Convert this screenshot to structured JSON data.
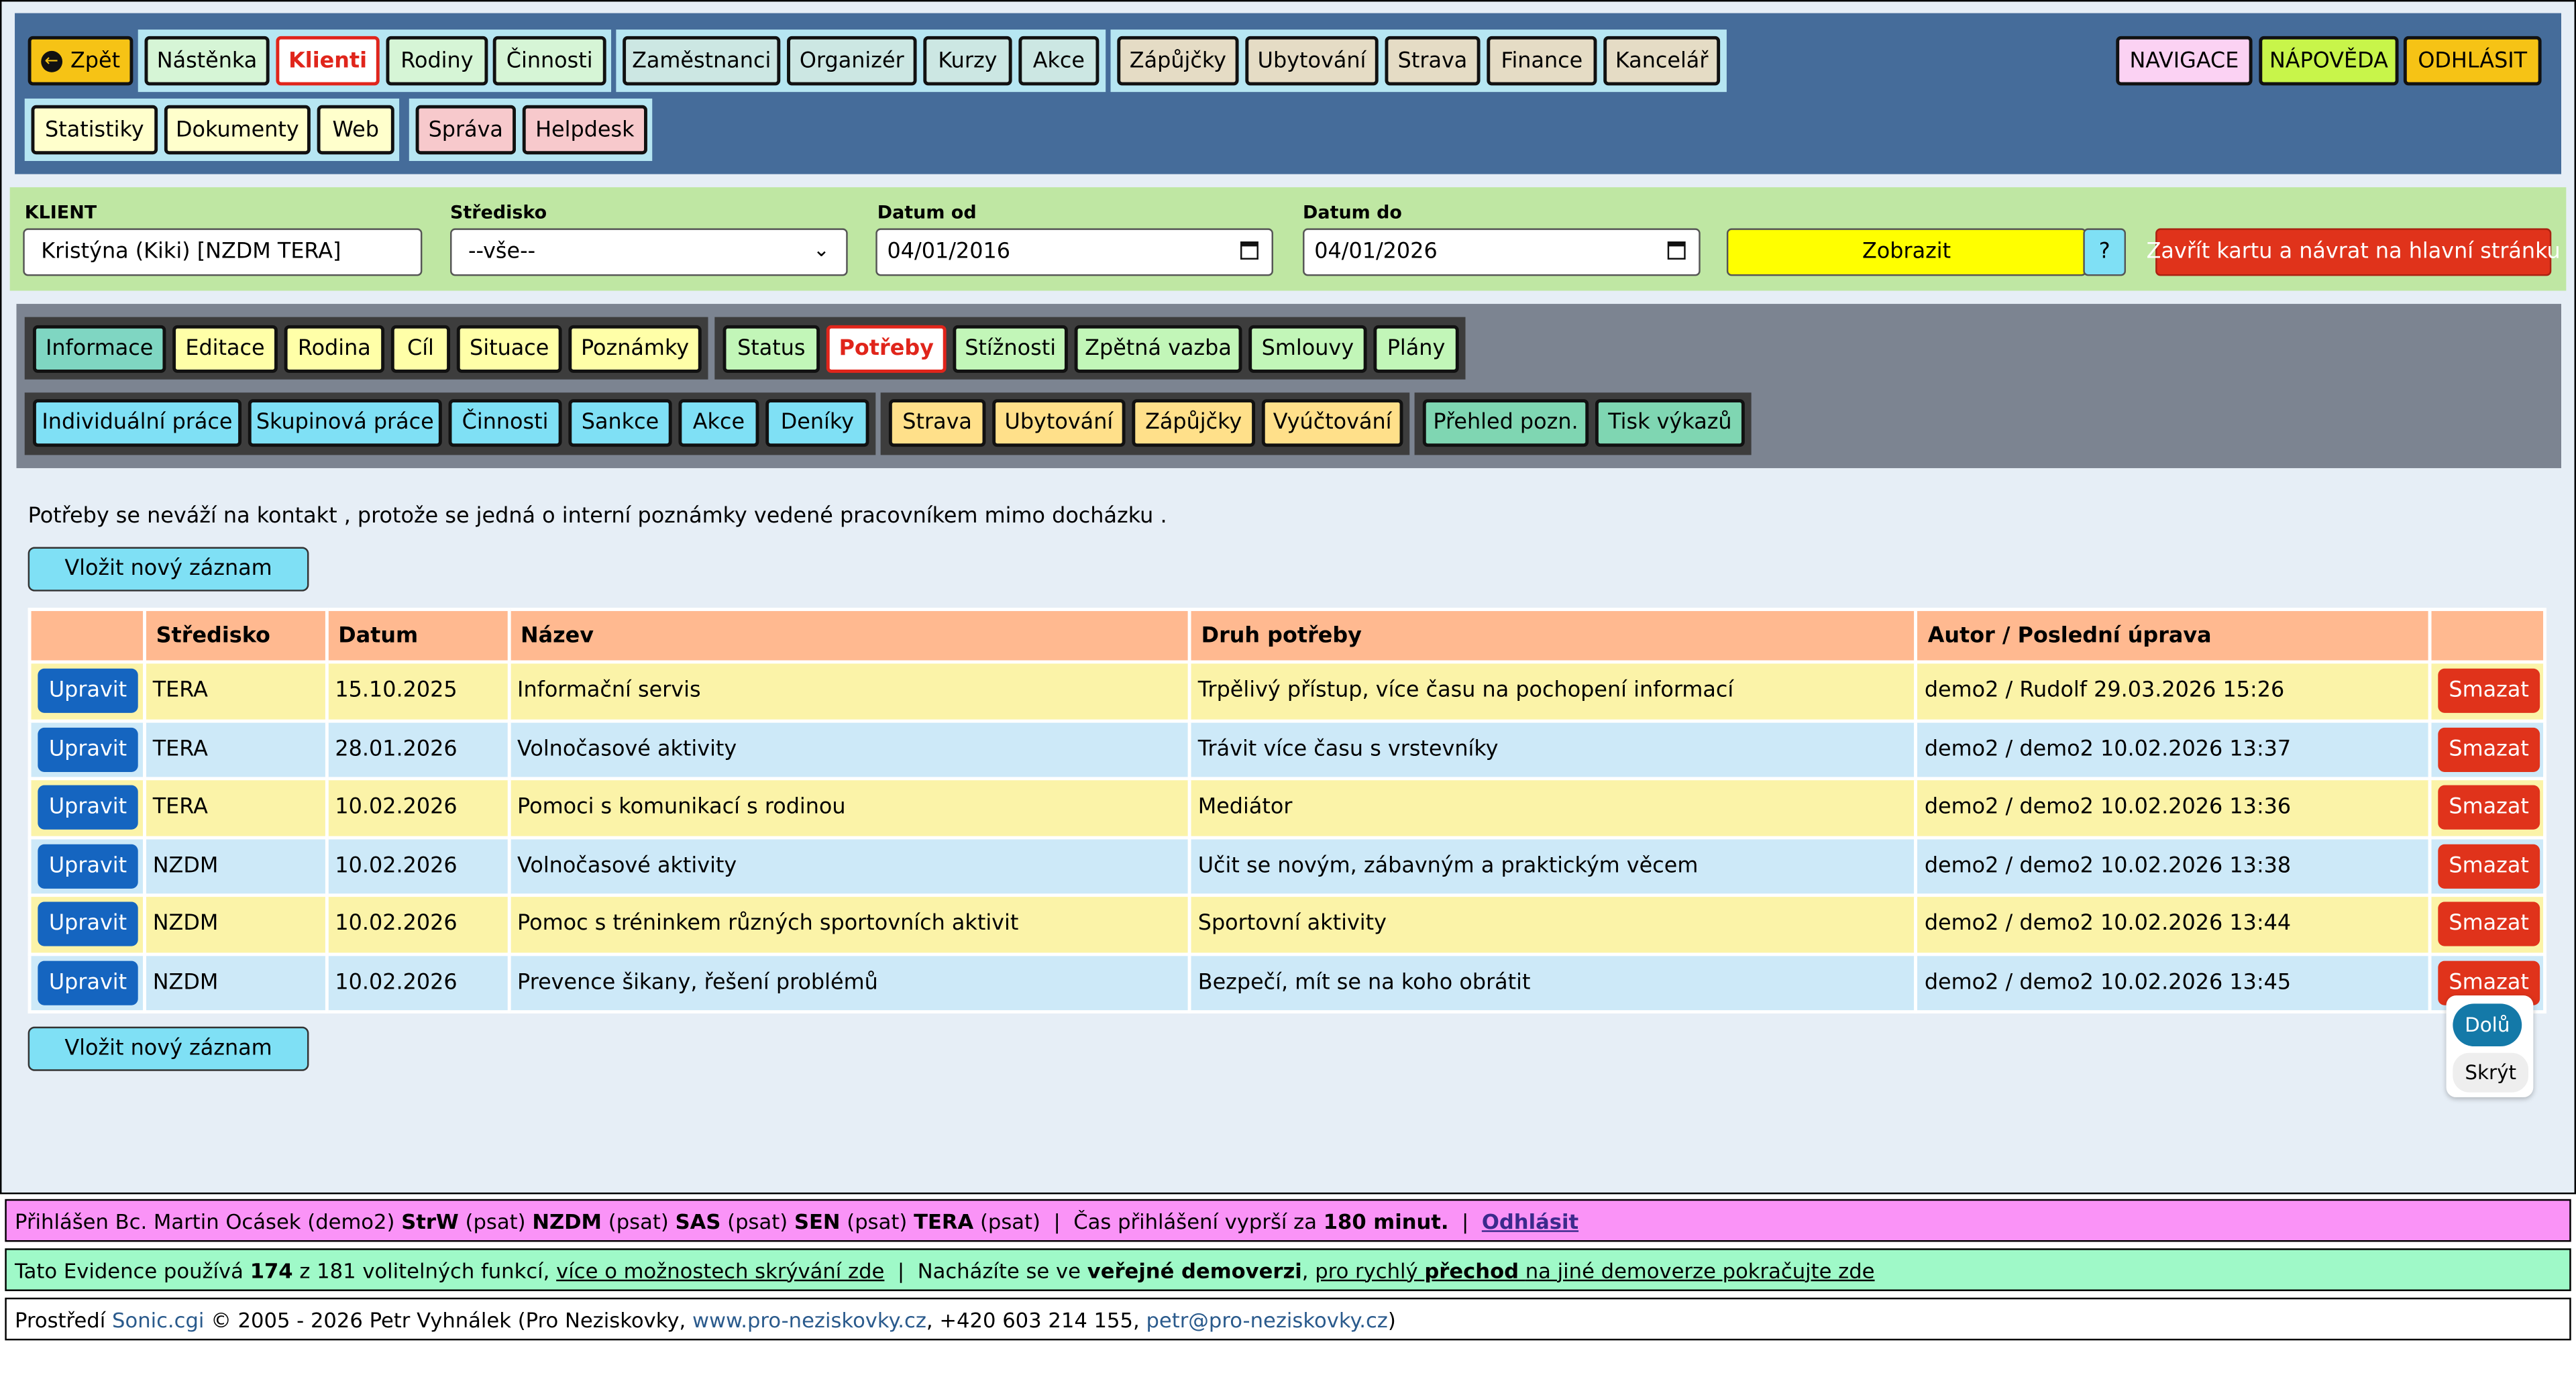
{
  "nav": {
    "back": "Zpět",
    "group1": [
      "Nástěnka",
      "Klienti",
      "Rodiny",
      "Činnosti"
    ],
    "group2": [
      "Zaměstnanci",
      "Organizér",
      "Kurzy",
      "Akce"
    ],
    "group3": [
      "Zápůjčky",
      "Ubytování",
      "Strava",
      "Finance",
      "Kancelář"
    ],
    "group4": [
      "Statistiky",
      "Dokumenty",
      "Web"
    ],
    "group5": [
      "Správa",
      "Helpdesk"
    ],
    "right": [
      "NAVIGACE",
      "NÁPOVĚDA",
      "ODHLÁSIT"
    ]
  },
  "filter": {
    "client_label": "KLIENT",
    "client_value": "Kristýna (Kiki) [NZDM TERA]",
    "center_label": "Středisko",
    "center_value": "--vše--",
    "from_label": "Datum od",
    "from_value": "04/01/2016",
    "to_label": "Datum do",
    "to_value": "04/01/2026",
    "show": "Zobrazit",
    "help": "?",
    "close": "Zavřít kartu a návrat na hlavní stránku"
  },
  "tabs": {
    "row1a": [
      "Informace",
      "Editace",
      "Rodina",
      "Cíl",
      "Situace",
      "Poznámky"
    ],
    "row1b": [
      "Status",
      "Potřeby",
      "Stížnosti",
      "Zpětná vazba",
      "Smlouvy",
      "Plány"
    ],
    "row2a": [
      "Individuální práce",
      "Skupinová práce",
      "Činnosti",
      "Sankce",
      "Akce",
      "Deníky"
    ],
    "row2b": [
      "Strava",
      "Ubytování",
      "Zápůjčky",
      "Vyúčtování"
    ],
    "row2c": [
      "Přehled pozn.",
      "Tisk výkazů"
    ]
  },
  "main": {
    "info": "Potřeby se neváží na kontakt , protože se jedná o interní poznámky vedené pracovníkem mimo docházku .",
    "new_record": "Vložit nový záznam",
    "columns": [
      "",
      "Středisko",
      "Datum",
      "Název",
      "Druh potřeby",
      "Autor / Poslední úprava",
      ""
    ],
    "edit_label": "Upravit",
    "delete_label": "Smazat",
    "rows": [
      {
        "center": "TERA",
        "date": "15.10.2025",
        "name": "Informační servis",
        "type": "Trpělivý přístup, více času na pochopení informací",
        "author": "demo2 / Rudolf 29.03.2026 15:26"
      },
      {
        "center": "TERA",
        "date": "28.01.2026",
        "name": "Volnočasové aktivity",
        "type": "Trávit více času s vrstevníky",
        "author": "demo2 / demo2 10.02.2026 13:37"
      },
      {
        "center": "TERA",
        "date": "10.02.2026",
        "name": "Pomoci s komunikací s rodinou",
        "type": "Mediátor",
        "author": "demo2 / demo2 10.02.2026 13:36"
      },
      {
        "center": "NZDM",
        "date": "10.02.2026",
        "name": "Volnočasové aktivity",
        "type": "Učit se novým, zábavným a praktickým věcem",
        "author": "demo2 / demo2 10.02.2026 13:38"
      },
      {
        "center": "NZDM",
        "date": "10.02.2026",
        "name": "Pomoc s tréninkem různých sportovních aktivit",
        "type": "Sportovní aktivity",
        "author": "demo2 / demo2 10.02.2026 13:44"
      },
      {
        "center": "NZDM",
        "date": "10.02.2026",
        "name": "Prevence šikany, řešení problémů",
        "type": "Bezpečí, mít se na koho obrátit",
        "author": "demo2 / demo2 10.02.2026 13:45"
      }
    ],
    "down": "Dolů",
    "hide": "Skrýt"
  },
  "footer": {
    "login_prefix": "Přihlášen Bc. Martin Ocásek (demo2)",
    "c1": "StrW",
    "p1": "(psat)",
    "c2": "NZDM",
    "p2": "(psat)",
    "c3": "SAS",
    "p3": "(psat)",
    "c4": "SEN",
    "p4": "(psat)",
    "c5": "TERA",
    "p5": "(psat)",
    "sep": "|",
    "expire_text": "Čas přihlášení vyprší za",
    "expire_value": "180 minut.",
    "logout": "Odhlásit",
    "func_prefix": "Tato Evidence používá",
    "func_used": "174",
    "func_total": "z 181 volitelných funkcí,",
    "func_link": "více o možnostech skrývání zde",
    "demo_text": "Nacházíte se ve",
    "demo_bold": "veřejné demoverzi",
    "demo_link_a": "pro rychlý",
    "demo_link_b": "přechod",
    "demo_link_c": "na jiné demoverze pokračujte zde",
    "env_prefix": "Prostředí",
    "env_link": "Sonic.cgi",
    "copyright": "© 2005 - 2026 Petr Vyhnálek (Pro Neziskovky,",
    "web": "www.pro-neziskovky.cz",
    "phone": ", +420 603 214 155,",
    "email": "petr@pro-neziskovky.cz",
    "close_paren": ")"
  },
  "colors": {
    "header_bg": "#456c9a",
    "filter_bg": "#bfe7a3",
    "tabs_bg": "#7c8491",
    "table_head": "#ffb990",
    "row_yellow": "#fbf3a8",
    "row_blue": "#cde9f8",
    "edit": "#1565c0",
    "delete": "#e0331b"
  }
}
